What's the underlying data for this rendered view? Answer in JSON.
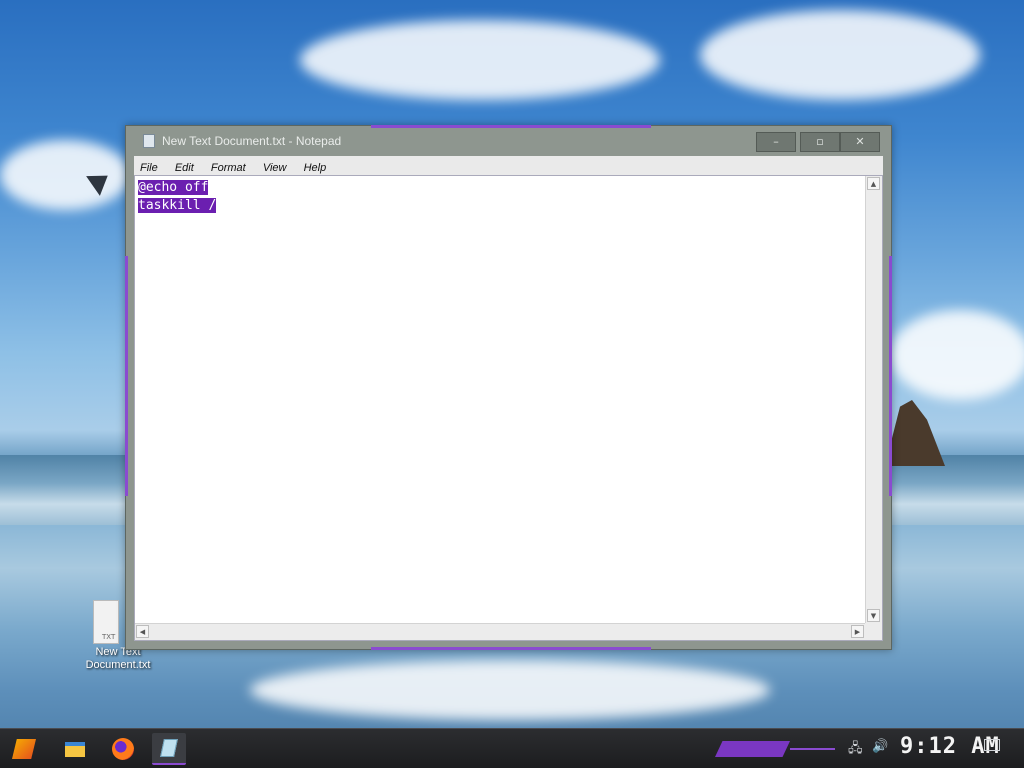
{
  "window": {
    "title": "New Text Document.txt - Notepad",
    "controls": {
      "minimize": "–",
      "maximize": "▫",
      "close": "✕"
    }
  },
  "menu": [
    "File",
    "Edit",
    "Format",
    "View",
    "Help"
  ],
  "editor": {
    "lines": [
      "@echo off",
      "taskkill /"
    ],
    "selection": "all"
  },
  "scrollbar": {
    "up": "▲",
    "down": "▼",
    "left": "◀",
    "right": "▶"
  },
  "desktop": {
    "icon_label_line1": "New Text",
    "icon_label_line2": "Document.txt",
    "icon_badge": "TXT"
  },
  "taskbar": {
    "apps": [
      "start-icon",
      "file-explorer-icon",
      "firefox-icon",
      "notepad-icon"
    ],
    "clock": "9:12 AM",
    "accent_color": "#7a37c2"
  },
  "colors": {
    "selection": "#6b1fb0",
    "window_frame": "#8e968f"
  }
}
